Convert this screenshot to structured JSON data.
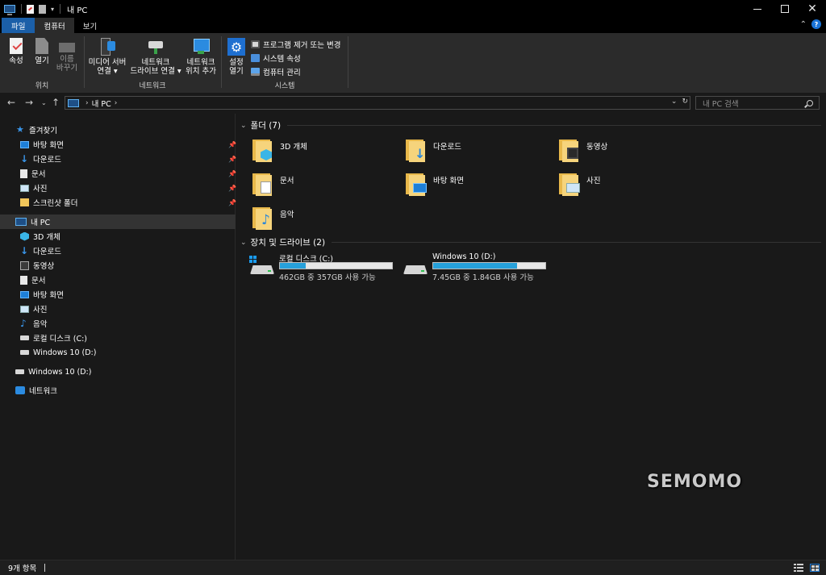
{
  "window": {
    "title": "내 PC"
  },
  "ribbon_tabs": [
    {
      "label": "파일"
    },
    {
      "label": "컴퓨터"
    },
    {
      "label": "보기"
    }
  ],
  "ribbon": {
    "location_group": {
      "label": "위치",
      "properties": "속성",
      "open": "열기",
      "rename_line1": "이름",
      "rename_line2": "바꾸기"
    },
    "network_group": {
      "label": "네트워크",
      "media_line1": "미디어 서버",
      "media_line2": "연결 ▾",
      "map_line1": "네트워크",
      "map_line2": "드라이브 연결 ▾",
      "add_line1": "네트워크",
      "add_line2": "위치 추가"
    },
    "system_group": {
      "label": "시스템",
      "settings_line1": "설정",
      "settings_line2": "열기",
      "uninstall": "프로그램 제거 또는 변경",
      "system_properties": "시스템 속성",
      "manage": "컴퓨터 관리"
    }
  },
  "address": {
    "path": "내 PC",
    "search_placeholder": "내 PC 검색"
  },
  "sidebar": {
    "quick_access": {
      "label": "즐겨찾기",
      "items": [
        {
          "label": "바탕 화면",
          "icon": "desktop-icon",
          "pinned": true
        },
        {
          "label": "다운로드",
          "icon": "download-icon",
          "pinned": true
        },
        {
          "label": "문서",
          "icon": "document-icon",
          "pinned": true
        },
        {
          "label": "사진",
          "icon": "pictures-icon",
          "pinned": true
        },
        {
          "label": "스크린샷 폴더",
          "icon": "folder-icon",
          "pinned": true
        }
      ]
    },
    "this_pc": {
      "label": "내 PC",
      "items": [
        {
          "label": "3D 개체",
          "icon": "3d-objects-icon"
        },
        {
          "label": "다운로드",
          "icon": "download-icon"
        },
        {
          "label": "동영상",
          "icon": "videos-icon"
        },
        {
          "label": "문서",
          "icon": "document-icon"
        },
        {
          "label": "바탕 화면",
          "icon": "desktop-icon"
        },
        {
          "label": "사진",
          "icon": "pictures-icon"
        },
        {
          "label": "음악",
          "icon": "music-icon"
        },
        {
          "label": "로컬 디스크 (C:)",
          "icon": "drive-icon"
        },
        {
          "label": "Windows 10 (D:)",
          "icon": "drive-icon"
        }
      ]
    },
    "usb_drive": {
      "label": "Windows 10 (D:)"
    },
    "network": {
      "label": "네트워크"
    }
  },
  "main": {
    "folders_header": "폴더 (7)",
    "folders": [
      {
        "name": "3D 개체",
        "icon": "3d-objects-folder-icon"
      },
      {
        "name": "다운로드",
        "icon": "downloads-folder-icon"
      },
      {
        "name": "동영상",
        "icon": "videos-folder-icon"
      },
      {
        "name": "문서",
        "icon": "documents-folder-icon"
      },
      {
        "name": "바탕 화면",
        "icon": "desktop-folder-icon"
      },
      {
        "name": "사진",
        "icon": "pictures-folder-icon"
      },
      {
        "name": "음악",
        "icon": "music-folder-icon"
      }
    ],
    "drives_header": "장치 및 드라이브 (2)",
    "drives": [
      {
        "name": "로컬 디스크 (C:)",
        "free_text": "462GB 중 357GB 사용 가능",
        "used_fraction": 0.23
      },
      {
        "name": "Windows 10 (D:)",
        "free_text": "7.45GB 중 1.84GB 사용 가능",
        "used_fraction": 0.75
      }
    ]
  },
  "watermark": "SEMOMO",
  "status": {
    "item_count": "9개 항목"
  },
  "colors": {
    "accent": "#1b5fa8",
    "drive_bar_fill": "#26a0da",
    "background": "#191919"
  }
}
